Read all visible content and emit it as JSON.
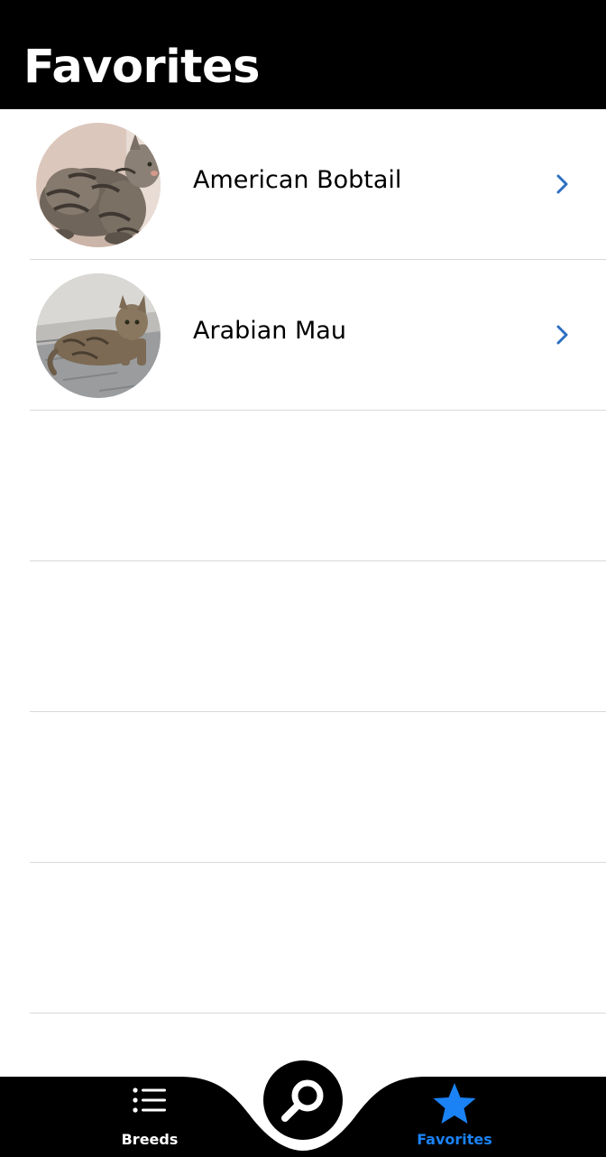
{
  "header": {
    "title": "Favorites"
  },
  "favorites": [
    {
      "name": "American Bobtail",
      "photo": "american-bobtail-photo"
    },
    {
      "name": "Arabian Mau",
      "photo": "arabian-mau-photo"
    }
  ],
  "tabbar": {
    "tabs": [
      {
        "label": "Breeds",
        "icon": "list-icon",
        "selected": false
      },
      {
        "label": "Favorites",
        "icon": "star-icon",
        "selected": true
      }
    ],
    "center_button_icon": "search-icon"
  },
  "colors": {
    "header_background": "#000000",
    "tabbar_background": "#000000",
    "accent": "#1a82f5",
    "chevron": "#2c6fc2",
    "separator": "#d9d9dc"
  }
}
